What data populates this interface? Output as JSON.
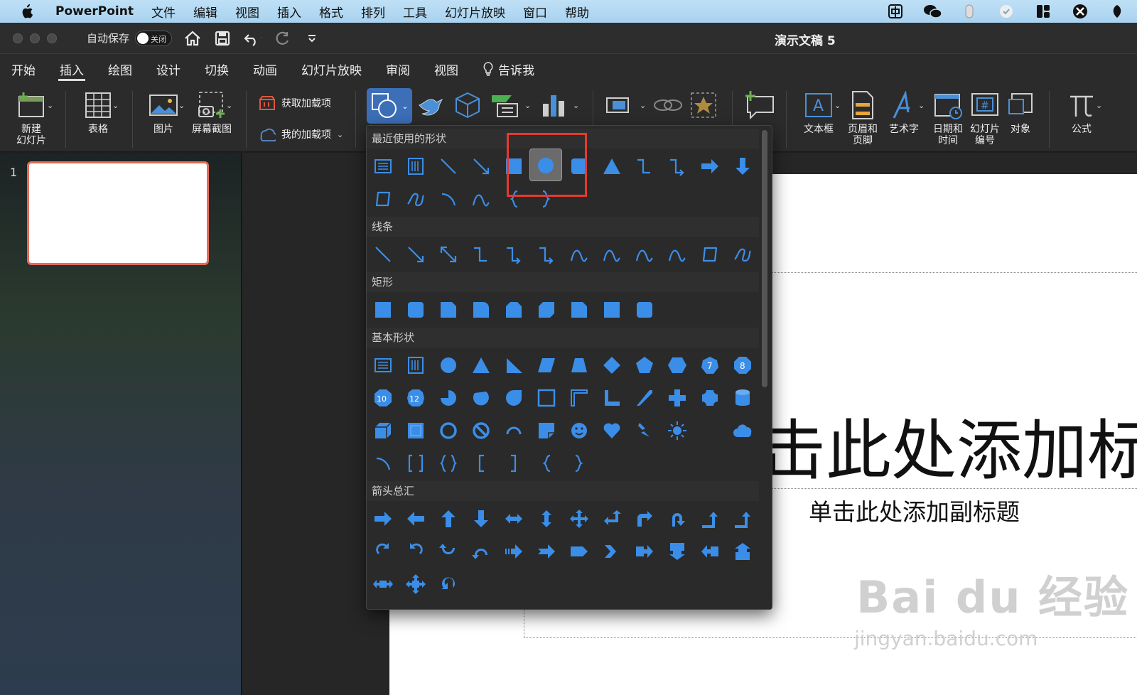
{
  "menubar": {
    "app_name": "PowerPoint",
    "items": [
      "文件",
      "编辑",
      "视图",
      "插入",
      "格式",
      "排列",
      "工具",
      "幻灯片放映",
      "窗口",
      "帮助"
    ]
  },
  "titlebar": {
    "autosave_label": "自动保存",
    "autosave_state": "关闭",
    "document_title": "演示文稿 5"
  },
  "tabs": {
    "items": [
      "开始",
      "插入",
      "绘图",
      "设计",
      "切换",
      "动画",
      "幻灯片放映",
      "审阅",
      "视图"
    ],
    "active": "插入",
    "tell_me": "告诉我"
  },
  "ribbon": {
    "new_slide": "新建\n幻灯片",
    "table": "表格",
    "picture": "图片",
    "screenshot": "屏幕截图",
    "get_addins": "获取加载项",
    "my_addins": "我的加载项",
    "textbox": "文本框",
    "header_footer": "页眉和\n页脚",
    "wordart": "艺术字",
    "date_time": "日期和\n时间",
    "slide_number": "幻灯片\n编号",
    "object": "对象",
    "equation": "公式"
  },
  "thumbnails": {
    "slide_number": "1"
  },
  "slide": {
    "title_placeholder": "击此处添加标",
    "subtitle_placeholder": "单击此处添加副标题"
  },
  "watermark": {
    "line1": "Bai du 经验",
    "line2": "jingyan.baidu.com"
  },
  "shapes_menu": {
    "sections": {
      "recent": "最近使用的形状",
      "lines": "线条",
      "rectangles": "矩形",
      "basic": "基本形状",
      "arrows": "箭头总汇"
    },
    "selected_shape": "oval"
  },
  "colors": {
    "shape_blue": "#3b8ee8",
    "highlight_red": "#e53a2e",
    "thumb_border": "#e66b57"
  }
}
